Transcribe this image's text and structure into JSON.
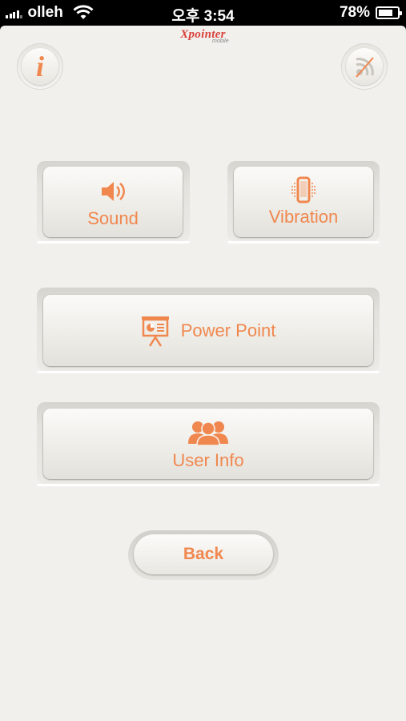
{
  "status_bar": {
    "carrier": "olleh",
    "time": "오후 3:54",
    "battery_text": "78%",
    "battery_level": 0.78
  },
  "header": {
    "logo_text": "Xpointer",
    "logo_subtext": "mobile"
  },
  "icons": {
    "info": "info-icon",
    "connection": "wireless-disconnected-icon"
  },
  "buttons": {
    "sound": "Sound",
    "vibration": "Vibration",
    "power_point": "Power Point",
    "user_info": "User Info",
    "back": "Back"
  },
  "colors": {
    "accent": "#f0874e",
    "background": "#f1f0ed",
    "logo": "#d9413a"
  }
}
